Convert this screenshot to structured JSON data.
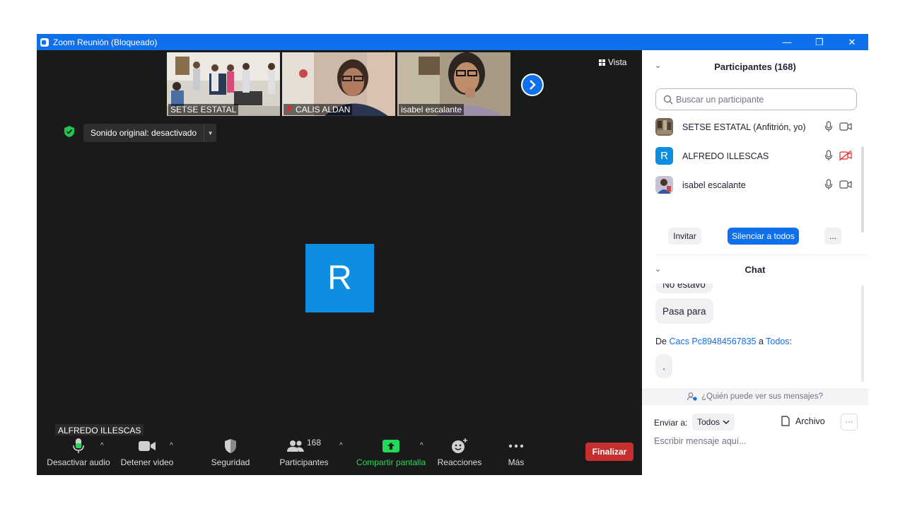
{
  "window": {
    "title": "Zoom Reunión (Bloqueado)",
    "minimize": "—",
    "restore": "❐",
    "close": "✕",
    "accent": "#0e71eb"
  },
  "gallery": {
    "thumbnails": [
      {
        "name": "SETSE ESTATAL",
        "muted": false
      },
      {
        "name": "CALIS ALDAN",
        "muted": true
      },
      {
        "name": "isabel escalante",
        "muted": false
      }
    ],
    "view_label": "Vista"
  },
  "sound": {
    "label": "Sonido original: desactivado"
  },
  "active_speaker": {
    "initial": "R",
    "name": "ALFREDO ILLESCAS",
    "color": "#0e8ee0"
  },
  "toolbar": {
    "audio": "Desactivar audio",
    "video": "Detener video",
    "security": "Seguridad",
    "participants": "Participantes",
    "participants_count": "168",
    "share": "Compartir pantalla",
    "reactions": "Reacciones",
    "more": "Más",
    "end": "Finalizar",
    "share_color": "#23d959",
    "end_color": "#c52f2f"
  },
  "participants_panel": {
    "title": "Participantes (168)",
    "search_placeholder": "Buscar un participante",
    "items": [
      {
        "name": "SETSE ESTATAL (Anfitrión, yo)",
        "avatar": "photo",
        "video_off": false
      },
      {
        "name": "ALFREDO ILLESCAS",
        "avatar": "R",
        "video_off": true
      },
      {
        "name": "isabel escalante",
        "avatar": "photo",
        "video_off": false
      }
    ],
    "invite": "Invitar",
    "mute_all": "Silenciar a todos",
    "more": "..."
  },
  "chat_panel": {
    "title": "Chat",
    "partial_message": "No estavo",
    "message_1": "Pasa para",
    "from_prefix": "De",
    "from_name": "Cacs Pc89484567835",
    "from_middle": "a",
    "from_target": "Todos",
    "from_suffix": ":",
    "message_2": ".",
    "who_can_see": "¿Quién puede ver sus mensajes?",
    "send_to_label": "Enviar a:",
    "send_to_value": "Todos",
    "file_label": "Archivo",
    "more": "···",
    "input_placeholder": "Escribir mensaje aquí..."
  }
}
